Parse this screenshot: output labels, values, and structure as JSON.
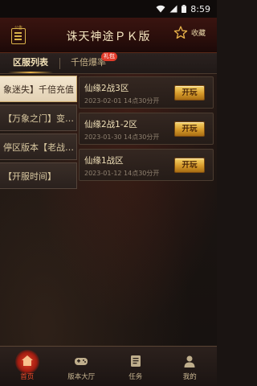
{
  "status_bar": {
    "time": "8:59"
  },
  "header": {
    "logo_text": "公告",
    "title": "诛天神途ＰＫ版",
    "favorite_label": "收藏"
  },
  "tabs": [
    {
      "label": "区服列表",
      "active": true
    },
    {
      "label": "千倍爆率",
      "badge": "礼包",
      "active": false
    }
  ],
  "left_menu": [
    {
      "label": "象迷失】千倍充值",
      "active": true
    },
    {
      "label": "【万象之门】变…",
      "active": false
    },
    {
      "label": "停区版本【老战…",
      "active": false
    },
    {
      "label": "【开服时间】",
      "active": false
    }
  ],
  "servers": [
    {
      "name": "仙缘2战3区",
      "time": "2023-02-01 14点30分开",
      "button": "开玩"
    },
    {
      "name": "仙缘2战1-2区",
      "time": "2023-01-30 14点30分开",
      "button": "开玩"
    },
    {
      "name": "仙缘1战区",
      "time": "2023-01-12 14点30分开",
      "button": "开玩"
    }
  ],
  "bottom_nav": [
    {
      "label": "首页",
      "icon": "home-icon",
      "active": true
    },
    {
      "label": "版本大厅",
      "icon": "gamepad-icon",
      "active": false
    },
    {
      "label": "任务",
      "icon": "task-icon",
      "active": false
    },
    {
      "label": "我的",
      "icon": "user-icon",
      "active": false
    }
  ],
  "colors": {
    "accent_gold": "#e8b24a",
    "active_red": "#f04a2a",
    "badge_red": "#e23b2a"
  }
}
